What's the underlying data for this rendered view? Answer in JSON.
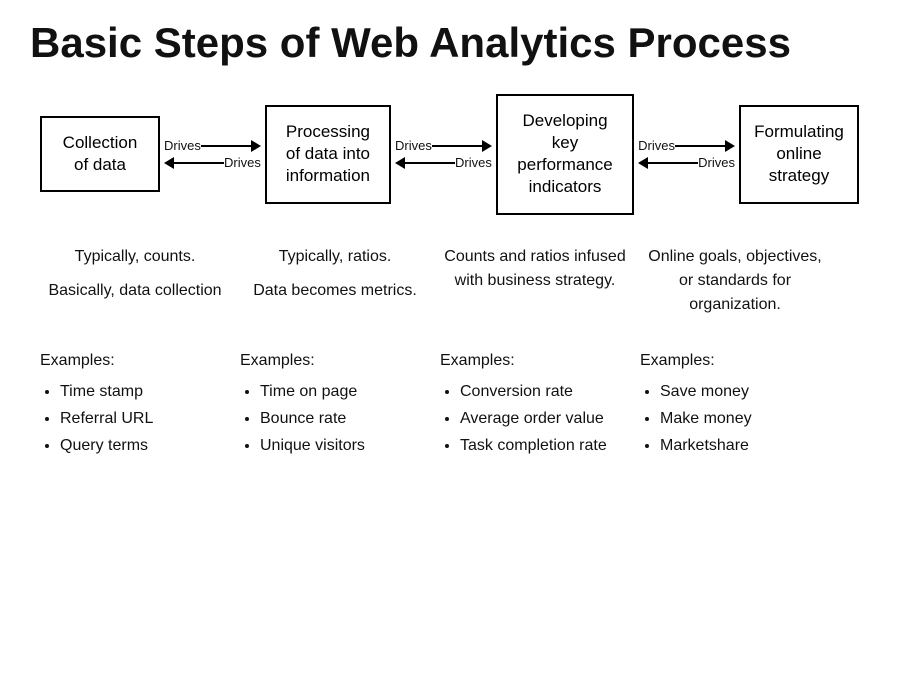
{
  "title": "Basic Steps of Web Analytics Process",
  "flow": {
    "boxes": [
      "Collection of data",
      "Processing of data into information",
      "Developing key performance indicators",
      "Formulating online strategy"
    ],
    "arrow_label": "Drives"
  },
  "descriptions": [
    {
      "lines": [
        "Typically, counts.",
        "Basically, data collection"
      ]
    },
    {
      "lines": [
        "Typically, ratios.",
        "Data becomes metrics."
      ]
    },
    {
      "lines": [
        "Counts and ratios infused with business strategy."
      ]
    },
    {
      "lines": [
        "Online goals, objectives, or standards for organization."
      ]
    }
  ],
  "examples": [
    {
      "title": "Examples:",
      "items": [
        "Time stamp",
        "Referral URL",
        "Query terms"
      ]
    },
    {
      "title": "Examples:",
      "items": [
        "Time on page",
        "Bounce rate",
        "Unique visitors"
      ]
    },
    {
      "title": "Examples:",
      "items": [
        "Conversion rate",
        "Average order value",
        "Task completion rate"
      ]
    },
    {
      "title": "Examples:",
      "items": [
        "Save money",
        "Make money",
        "Marketshare"
      ]
    }
  ]
}
